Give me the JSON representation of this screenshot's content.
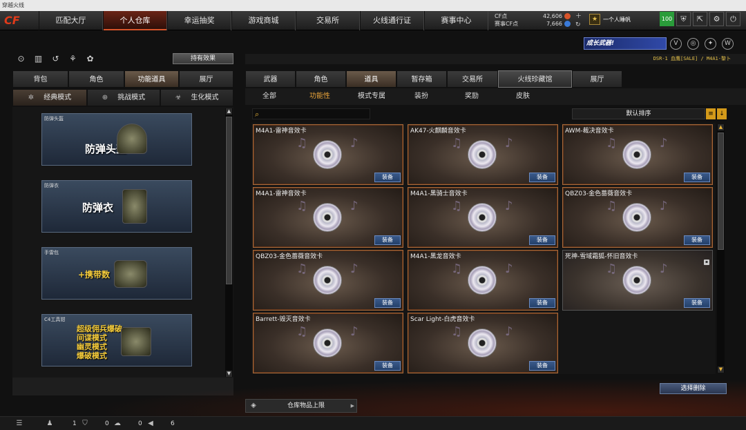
{
  "window": {
    "title": "穿越火线"
  },
  "logo": {
    "text": "CF"
  },
  "nav": {
    "tabs": [
      {
        "label": "匹配大厅"
      },
      {
        "label": "个人仓库"
      },
      {
        "label": "幸运抽奖"
      },
      {
        "label": "游戏商城"
      },
      {
        "label": "交易所"
      },
      {
        "label": "火线通行证"
      },
      {
        "label": "赛事中心"
      }
    ],
    "active_index": 1
  },
  "currency": {
    "cf_label": "CF点",
    "cf_value": "42,606",
    "match_label": "赛事CF点",
    "match_value": "7,666"
  },
  "user": {
    "name": "一个人睡帆"
  },
  "top_icons": {
    "level": "100"
  },
  "banner": {
    "text": "成长武器!"
  },
  "ticker": {
    "text": "DSR-1 血鹰[SALE] / M4A1-黎卜"
  },
  "left": {
    "effect_button": "持有效果",
    "category_tabs": [
      {
        "label": "背包"
      },
      {
        "label": "角色"
      },
      {
        "label": "功能道具"
      },
      {
        "label": "展厅"
      }
    ],
    "mode_tabs": [
      {
        "label": "经典模式"
      },
      {
        "label": "挑战模式"
      },
      {
        "label": "生化模式"
      }
    ],
    "items": [
      {
        "label": "防弹头盔",
        "text": "防弹头盔"
      },
      {
        "label": "防弹衣",
        "text": "防弹衣"
      },
      {
        "label": "手雷包",
        "text": "+携带数"
      },
      {
        "label": "C4工具钳",
        "lines": [
          "超级佣兵爆破",
          "间谍模式",
          "幽灵模式",
          "爆破模式"
        ]
      }
    ]
  },
  "right": {
    "category_tabs": [
      {
        "label": "武器"
      },
      {
        "label": "角色"
      },
      {
        "label": "道具"
      },
      {
        "label": "暂存箱"
      },
      {
        "label": "交易所"
      },
      {
        "label": "火线珍藏馆"
      },
      {
        "label": "展厅"
      }
    ],
    "filter_tabs": [
      {
        "label": "全部"
      },
      {
        "label": "功能性"
      },
      {
        "label": "模式专属"
      },
      {
        "label": "装扮"
      },
      {
        "label": "奖励"
      },
      {
        "label": "皮肤"
      }
    ],
    "sort_label": "默认排序",
    "equip_label": "装备",
    "items": [
      {
        "name": "M4A1-雷神音效卡"
      },
      {
        "name": "AK47-火麒麟音效卡"
      },
      {
        "name": "AWM-裁决音效卡"
      },
      {
        "name": "M4A1-雷神音效卡"
      },
      {
        "name": "M4A1-黑骑士音效卡"
      },
      {
        "name": "QBZ03-金色蔷薇音效卡"
      },
      {
        "name": "QBZ03-金色蔷薇音效卡"
      },
      {
        "name": "M4A1-黑龙音效卡"
      },
      {
        "name": "死神-雪域霜狐-怀旧音效卡"
      },
      {
        "name": "Barrett-毁灭音效卡"
      },
      {
        "name": "Scar Light-白虎音效卡"
      }
    ],
    "delete_button": "选择删除",
    "capacity_label": "仓库物品上限"
  },
  "status": {
    "count1": "1",
    "count2": "0",
    "count3": "0",
    "count4": "6"
  },
  "colors": {
    "accent": "#e8a33a",
    "card_border": "#a86a3a",
    "equip": "#24406a"
  }
}
